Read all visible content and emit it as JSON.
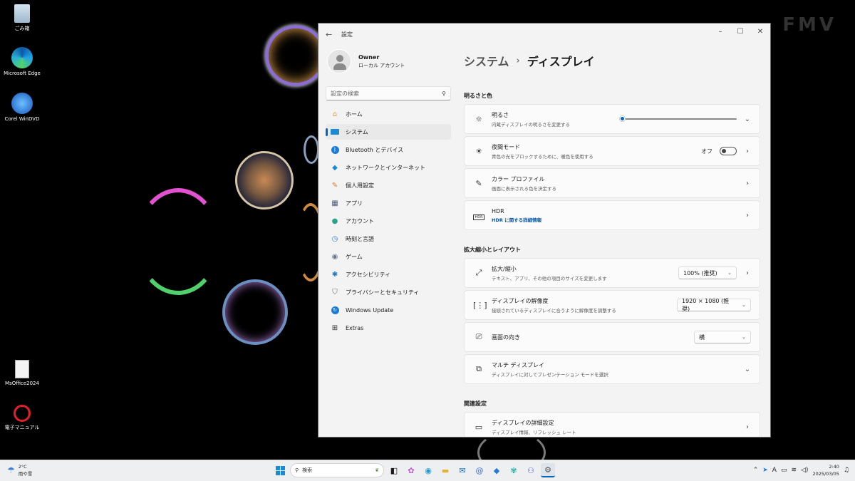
{
  "desktop": {
    "brand": "FMV",
    "icons": [
      {
        "label": "ごみ箱",
        "icon": "recycle-bin-icon"
      },
      {
        "label": "Microsoft Edge",
        "icon": "edge-icon"
      },
      {
        "label": "Corel WinDVD",
        "icon": "windvd-icon"
      },
      {
        "label": "MsOffice2024",
        "icon": "document-icon"
      },
      {
        "label": "電子マニュアル",
        "icon": "manual-icon"
      }
    ]
  },
  "window": {
    "title": "設定",
    "controls": [
      "–",
      "☐",
      "✕"
    ],
    "user": {
      "name": "Owner",
      "account": "ローカル アカウント"
    },
    "search_placeholder": "設定の検索",
    "nav": [
      {
        "label": "ホーム",
        "icon": "home-icon"
      },
      {
        "label": "システム",
        "icon": "system-icon",
        "active": true
      },
      {
        "label": "Bluetooth とデバイス",
        "icon": "bluetooth-icon"
      },
      {
        "label": "ネットワークとインターネット",
        "icon": "network-icon"
      },
      {
        "label": "個人用設定",
        "icon": "brush-icon"
      },
      {
        "label": "アプリ",
        "icon": "apps-icon"
      },
      {
        "label": "アカウント",
        "icon": "account-icon"
      },
      {
        "label": "時刻と言語",
        "icon": "time-language-icon"
      },
      {
        "label": "ゲーム",
        "icon": "game-icon"
      },
      {
        "label": "アクセシビリティ",
        "icon": "accessibility-icon"
      },
      {
        "label": "プライバシーとセキュリティ",
        "icon": "shield-icon"
      },
      {
        "label": "Windows Update",
        "icon": "update-icon"
      },
      {
        "label": "Extras",
        "icon": "extras-icon"
      }
    ],
    "breadcrumb": {
      "parent": "システム",
      "separator": "›",
      "current": "ディスプレイ"
    },
    "sections": {
      "brightness_header": "明るさと色",
      "scale_header": "拡大縮小とレイアウト",
      "related_header": "関連設定"
    },
    "brightness": {
      "title": "明るさ",
      "subtitle": "内蔵ディスプレイの明るさを変更する",
      "value": 0
    },
    "night_light": {
      "title": "夜間モード",
      "subtitle": "青色の光をブロックするために、暖色を使用する",
      "state": "オフ"
    },
    "color_profile": {
      "title": "カラー プロファイル",
      "subtitle": "画面に表示される色を決定する"
    },
    "hdr": {
      "title": "HDR",
      "subtitle": "HDR に関する詳細情報"
    },
    "scale": {
      "title": "拡大/縮小",
      "subtitle": "テキスト、アプリ、その他の項目のサイズを変更します",
      "value": "100% (推奨)"
    },
    "resolution": {
      "title": "ディスプレイの解像度",
      "subtitle": "接続されているディスプレイに合うように解像度を調整する",
      "value": "1920 × 1080 (推奨)"
    },
    "orientation": {
      "title": "画面の向き",
      "value": "横"
    },
    "multi": {
      "title": "マルチ ディスプレイ",
      "subtitle": "ディスプレイに対してプレゼンテーション モードを選択"
    },
    "advanced": {
      "title": "ディスプレイの詳細設定",
      "subtitle": "ディスプレイ情報、リフレッシュ レート"
    }
  },
  "taskbar": {
    "weather": {
      "temp": "2°C",
      "desc": "雨や雪"
    },
    "search_placeholder": "検索",
    "clock": {
      "time": "2:40",
      "date": "2025/03/05"
    },
    "ime": "A"
  },
  "colors": {
    "accent": "#0067c0",
    "window_bg": "#f3f3f3"
  }
}
